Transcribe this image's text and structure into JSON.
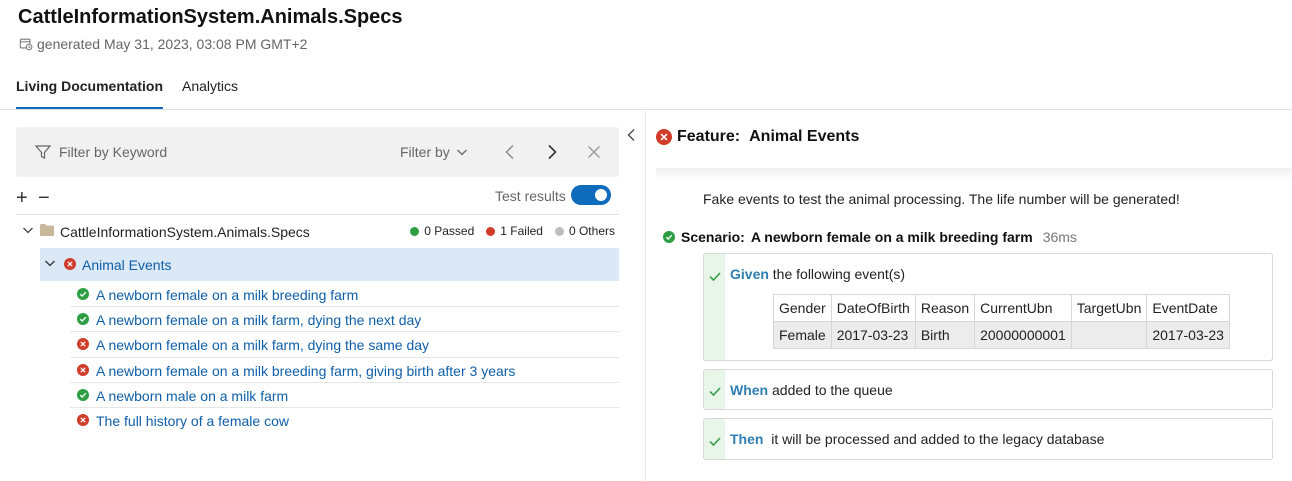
{
  "header": {
    "title": "CattleInformationSystem.Animals.Specs",
    "generated": "generated May 31, 2023, 03:08 PM GMT+2"
  },
  "tabs": [
    {
      "label": "Living Documentation",
      "active": true
    },
    {
      "label": "Analytics",
      "active": false
    }
  ],
  "filter": {
    "keyword_placeholder": "Filter by Keyword",
    "filter_by": "Filter by"
  },
  "toolbar": {
    "expand": "+",
    "collapse": "−",
    "test_results_label": "Test results",
    "test_results_on": true
  },
  "tree": {
    "root": {
      "name": "CattleInformationSystem.Animals.Specs",
      "passed": "0 Passed",
      "failed": "1 Failed",
      "others": "0 Others"
    },
    "feature": {
      "name": "Animal Events",
      "status": "failed"
    },
    "scenarios": [
      {
        "name": "A newborn female on a milk breeding farm",
        "status": "passed"
      },
      {
        "name": "A newborn female on a milk farm, dying the next day",
        "status": "passed"
      },
      {
        "name": "A newborn female on a milk farm, dying the same day",
        "status": "failed"
      },
      {
        "name": "A newborn female on a milk breeding farm, giving birth after 3 years",
        "status": "failed"
      },
      {
        "name": "A newborn male on a milk farm",
        "status": "passed"
      },
      {
        "name": "The full history of a female cow",
        "status": "failed"
      }
    ]
  },
  "detail": {
    "feature_keyword": "Feature:",
    "feature_name": "Animal Events",
    "description": "Fake events to test the animal processing. The life number will be generated!",
    "scenario_keyword": "Scenario:",
    "scenario_name": "A newborn female on a milk breeding farm",
    "scenario_duration": "36ms",
    "steps": [
      {
        "keyword": "Given",
        "text": "the following event(s)"
      },
      {
        "keyword": "When",
        "text": "added to the queue"
      },
      {
        "keyword": "Then",
        "text": "it will be processed and added to the legacy database"
      }
    ],
    "table": {
      "headers": [
        "Gender",
        "DateOfBirth",
        "Reason",
        "CurrentUbn",
        "TargetUbn",
        "EventDate"
      ],
      "row": [
        "Female",
        "2017-03-23",
        "Birth",
        "20000000001",
        "",
        "2017-03-23"
      ]
    }
  },
  "colors": {
    "accent": "#0f6cbd",
    "passed": "#2e9e44",
    "failed": "#d13b2a",
    "others": "#bdbdbd"
  }
}
